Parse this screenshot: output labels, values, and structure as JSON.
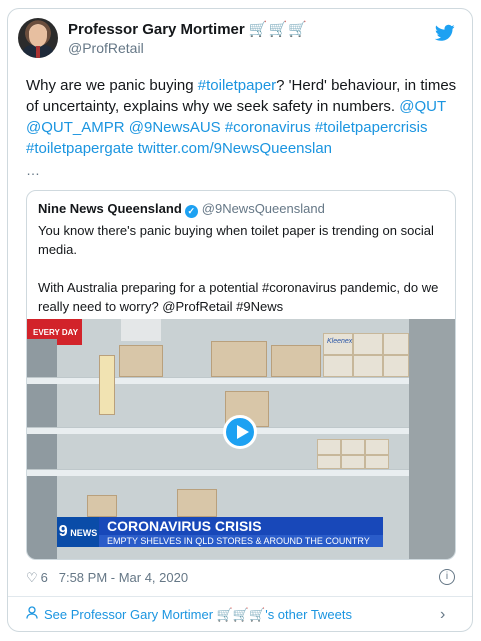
{
  "author": {
    "name": "Professor Gary Mortimer",
    "name_emoji": "🛒🛒🛒",
    "handle": "@ProfRetail"
  },
  "tweet": {
    "text_plain_1": "Why are we panic buying ",
    "hashtag_toiletpaper": "#toiletpaper",
    "text_plain_2": "? 'Herd' behaviour, in times of uncertainty, explains why we seek safety in numbers.",
    "mention_qut": "@QUT",
    "mention_qut_ampr": "@QUT_AMPR",
    "mention_9news": "@9NewsAUS",
    "hashtag_coronavirus": "#coronavirus",
    "hashtag_crisis": "#toiletpapercrisis",
    "hashtag_gate": "#toiletpapergate",
    "url": "twitter.com/9NewsQueenslan",
    "ellipsis": "…"
  },
  "quoted": {
    "name": "Nine News Queensland",
    "verified_glyph": "✓",
    "handle": "@9NewsQueensland",
    "line1": "You know there's panic buying when toilet paper is trending on social media.",
    "line2": "With Australia preparing for a potential #coronavirus pandemic, do we really need to worry? @ProfRetail #9News",
    "media": {
      "store_sign": "EVERY DAY",
      "brand": "Kleenex",
      "logo_small": "9",
      "logo_text": "NEWS",
      "headline": "CORONAVIRUS CRISIS",
      "subheadline": "EMPTY SHELVES IN QLD STORES & AROUND THE COUNTRY"
    }
  },
  "meta": {
    "heart_icon": "♡",
    "likes": "6",
    "time": "7:58 PM - Mar 4, 2020",
    "info_glyph": "i"
  },
  "footer": {
    "label": "See Professor Gary Mortimer 🛒🛒🛒's other Tweets",
    "chevron": "›"
  },
  "colors": {
    "link": "#1b95e0",
    "twitter_blue": "#1da1f2",
    "news_blue": "#1848b9"
  }
}
